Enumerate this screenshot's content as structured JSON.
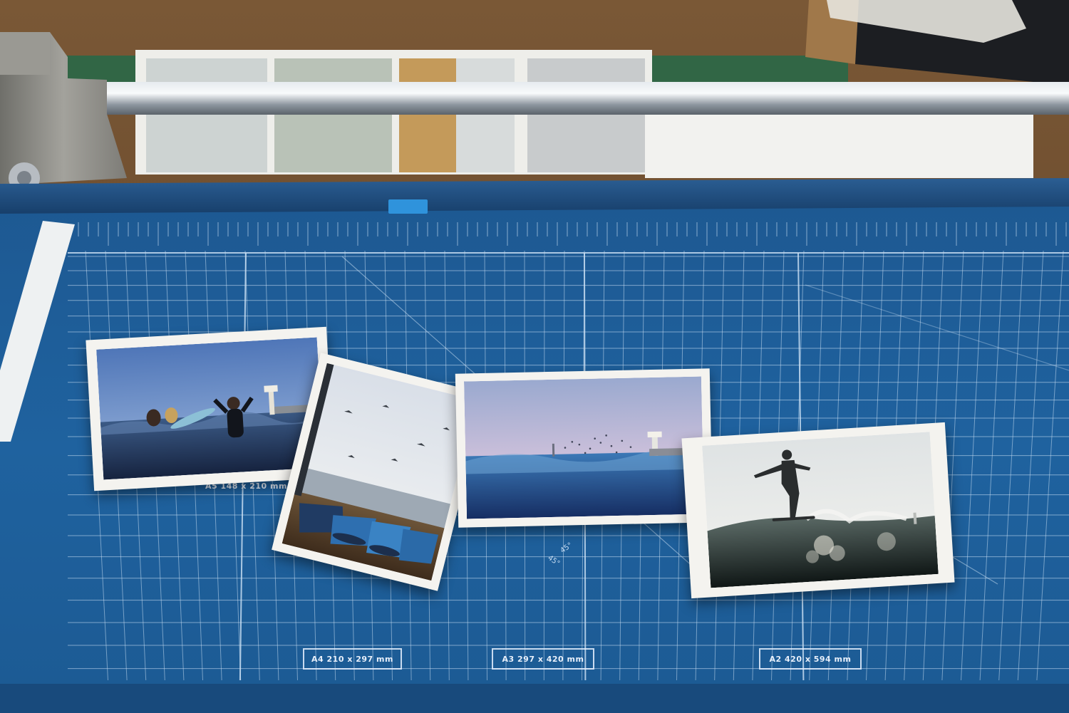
{
  "scene": {
    "subject": "rotary paper trimmer with blue cutting mat and printed surf photographs",
    "colors": {
      "table": "#6b4a2e",
      "mat": "#1f5f9a",
      "mat_dark": "#174a7a",
      "grid_line": "#cfe3f6",
      "rail": "#aab3bd",
      "housing": "#8c8c86",
      "tape": "#2f8fd8"
    }
  },
  "mat_labels": {
    "a5": "A5  148 x 210 mm",
    "a4": "A4  210 x 297 mm",
    "a3": "A3  297 x 420 mm",
    "a2": "A2  420 x 594 mm",
    "angle_1": "45°",
    "angle_2": "45°"
  },
  "photos": [
    {
      "name": "surfers-waving",
      "description": "surfers waist-deep in ocean under blue sky with tower"
    },
    {
      "name": "fishing-boats",
      "description": "blue wooden fishing boats on sandy beach with birds"
    },
    {
      "name": "twilight-sea",
      "description": "calm twilight sea with lighthouse tower on jetty"
    },
    {
      "name": "longboard-silhouette",
      "description": "silhouetted surfer riding longboard on wave"
    }
  ]
}
